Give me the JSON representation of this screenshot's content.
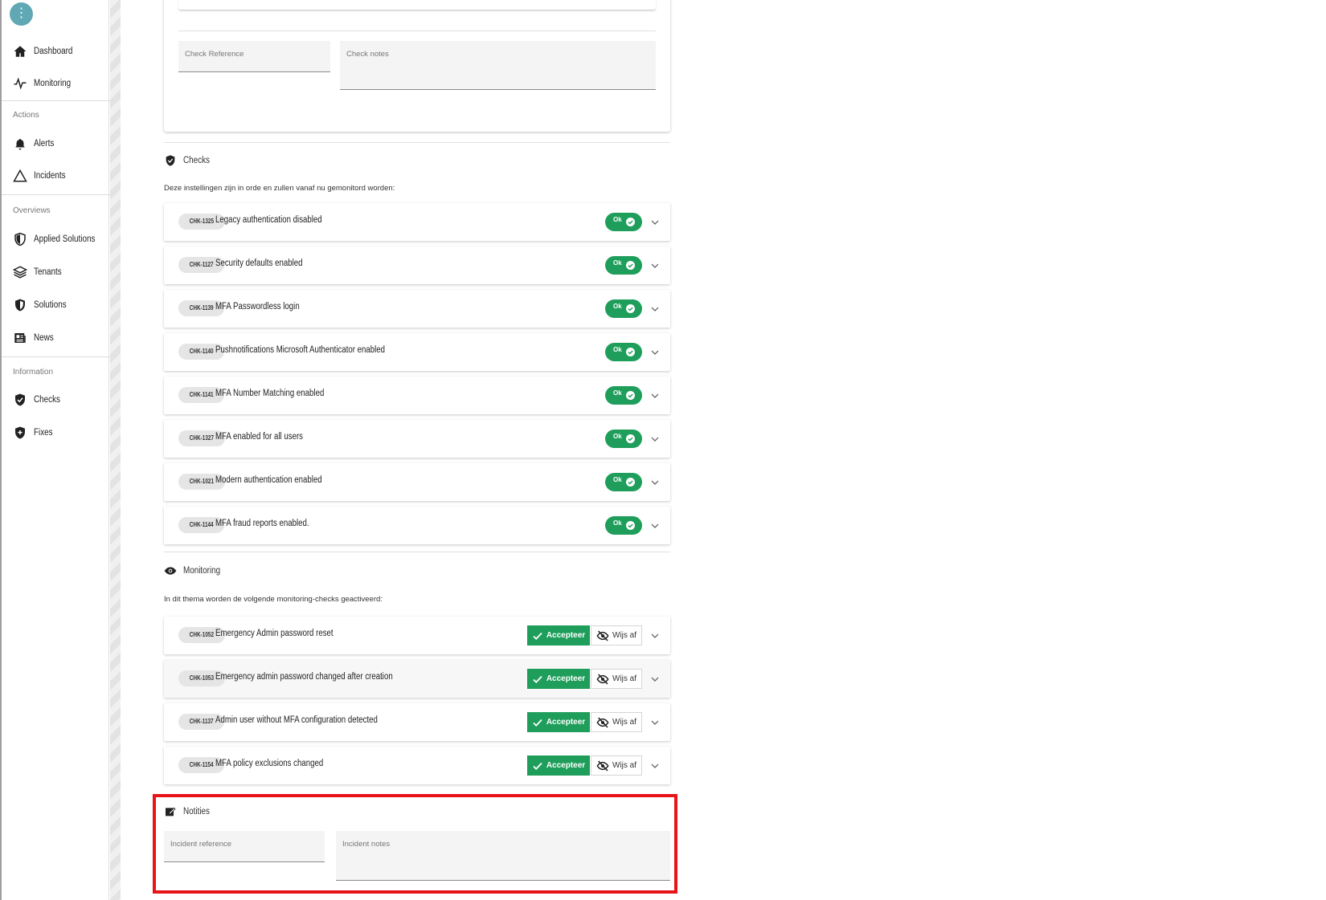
{
  "sidebar": {
    "menu_glyph": "⋮",
    "items_main": [
      {
        "label": "Dashboard",
        "icon": "home-icon"
      },
      {
        "label": "Monitoring",
        "icon": "pulse-icon"
      }
    ],
    "sections": [
      {
        "title": "Actions",
        "items": [
          {
            "label": "Alerts",
            "icon": "bell-icon"
          },
          {
            "label": "Incidents",
            "icon": "warning-triangle-icon"
          }
        ]
      },
      {
        "title": "Overviews",
        "items": [
          {
            "label": "Applied Solutions",
            "icon": "shield-half-icon"
          },
          {
            "label": "Tenants",
            "icon": "layers-icon"
          },
          {
            "label": "Solutions",
            "icon": "shield-icon"
          },
          {
            "label": "News",
            "icon": "newspaper-icon"
          }
        ]
      },
      {
        "title": "Information",
        "items": [
          {
            "label": "Checks",
            "icon": "shield-check-icon"
          },
          {
            "label": "Fixes",
            "icon": "shield-plus-icon"
          }
        ]
      }
    ]
  },
  "top_card": {
    "check_reference_placeholder": "Check Reference",
    "check_notes_placeholder": "Check notes"
  },
  "checks": {
    "title": "Checks",
    "description": "Deze instellingen zijn in orde en zullen vanaf nu gemonitord worden:",
    "status_label": "Ok",
    "items": [
      {
        "id": "CHK-1325",
        "title": "Legacy authentication disabled"
      },
      {
        "id": "CHK-1127",
        "title": "Security defaults enabled"
      },
      {
        "id": "CHK-1139",
        "title": "MFA Passwordless login"
      },
      {
        "id": "CHK-1140",
        "title": "Pushnotifications Microsoft Authenticator enabled"
      },
      {
        "id": "CHK-1141",
        "title": "MFA Number Matching enabled"
      },
      {
        "id": "CHK-1327",
        "title": "MFA enabled for all users"
      },
      {
        "id": "CHK-1021",
        "title": "Modern authentication enabled"
      },
      {
        "id": "CHK-1144",
        "title": "MFA fraud reports enabled."
      }
    ]
  },
  "monitoring": {
    "title": "Monitoring",
    "description": "In dit thema worden de volgende monitoring-checks geactiveerd:",
    "accept_label": "Accepteer",
    "reject_label": "Wijs af",
    "items": [
      {
        "id": "CHK-1052",
        "title": "Emergency Admin password reset"
      },
      {
        "id": "CHK-1053",
        "title": "Emergency admin password changed after creation"
      },
      {
        "id": "CHK-1137",
        "title": "Admin user without MFA configuration detected"
      },
      {
        "id": "CHK-1154",
        "title": "MFA policy exclusions changed"
      }
    ]
  },
  "notes": {
    "title": "Notities",
    "incident_reference_placeholder": "Incident reference",
    "incident_notes_placeholder": "Incident notes"
  },
  "colors": {
    "accent_green": "#1e9e5a",
    "fab_teal": "#5fa8b4",
    "highlight_red": "#e8141a"
  }
}
